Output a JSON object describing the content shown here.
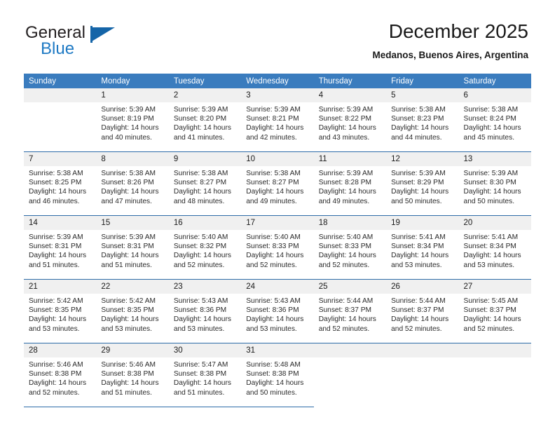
{
  "brand": {
    "name_part1": "General",
    "name_part2": "Blue",
    "logo_icon": "triangle-logo-icon",
    "accent_color": "#1565a8"
  },
  "header": {
    "month_title": "December 2025",
    "location": "Medanos, Buenos Aires, Argentina"
  },
  "theme": {
    "header_row_color": "#3a7cbe",
    "daynum_bg_color": "#f0f0f0",
    "week_separator_color": "#2d6ca8",
    "text_color": "#2a2a2a"
  },
  "calendar": {
    "weekday_headers": [
      "Sunday",
      "Monday",
      "Tuesday",
      "Wednesday",
      "Thursday",
      "Friday",
      "Saturday"
    ],
    "weeks": [
      [
        {
          "day": "",
          "blank": true
        },
        {
          "day": "1",
          "sunrise": "Sunrise: 5:39 AM",
          "sunset": "Sunset: 8:19 PM",
          "daylight": "Daylight: 14 hours and 40 minutes."
        },
        {
          "day": "2",
          "sunrise": "Sunrise: 5:39 AM",
          "sunset": "Sunset: 8:20 PM",
          "daylight": "Daylight: 14 hours and 41 minutes."
        },
        {
          "day": "3",
          "sunrise": "Sunrise: 5:39 AM",
          "sunset": "Sunset: 8:21 PM",
          "daylight": "Daylight: 14 hours and 42 minutes."
        },
        {
          "day": "4",
          "sunrise": "Sunrise: 5:39 AM",
          "sunset": "Sunset: 8:22 PM",
          "daylight": "Daylight: 14 hours and 43 minutes."
        },
        {
          "day": "5",
          "sunrise": "Sunrise: 5:38 AM",
          "sunset": "Sunset: 8:23 PM",
          "daylight": "Daylight: 14 hours and 44 minutes."
        },
        {
          "day": "6",
          "sunrise": "Sunrise: 5:38 AM",
          "sunset": "Sunset: 8:24 PM",
          "daylight": "Daylight: 14 hours and 45 minutes."
        }
      ],
      [
        {
          "day": "7",
          "sunrise": "Sunrise: 5:38 AM",
          "sunset": "Sunset: 8:25 PM",
          "daylight": "Daylight: 14 hours and 46 minutes."
        },
        {
          "day": "8",
          "sunrise": "Sunrise: 5:38 AM",
          "sunset": "Sunset: 8:26 PM",
          "daylight": "Daylight: 14 hours and 47 minutes."
        },
        {
          "day": "9",
          "sunrise": "Sunrise: 5:38 AM",
          "sunset": "Sunset: 8:27 PM",
          "daylight": "Daylight: 14 hours and 48 minutes."
        },
        {
          "day": "10",
          "sunrise": "Sunrise: 5:38 AM",
          "sunset": "Sunset: 8:27 PM",
          "daylight": "Daylight: 14 hours and 49 minutes."
        },
        {
          "day": "11",
          "sunrise": "Sunrise: 5:39 AM",
          "sunset": "Sunset: 8:28 PM",
          "daylight": "Daylight: 14 hours and 49 minutes."
        },
        {
          "day": "12",
          "sunrise": "Sunrise: 5:39 AM",
          "sunset": "Sunset: 8:29 PM",
          "daylight": "Daylight: 14 hours and 50 minutes."
        },
        {
          "day": "13",
          "sunrise": "Sunrise: 5:39 AM",
          "sunset": "Sunset: 8:30 PM",
          "daylight": "Daylight: 14 hours and 50 minutes."
        }
      ],
      [
        {
          "day": "14",
          "sunrise": "Sunrise: 5:39 AM",
          "sunset": "Sunset: 8:31 PM",
          "daylight": "Daylight: 14 hours and 51 minutes."
        },
        {
          "day": "15",
          "sunrise": "Sunrise: 5:39 AM",
          "sunset": "Sunset: 8:31 PM",
          "daylight": "Daylight: 14 hours and 51 minutes."
        },
        {
          "day": "16",
          "sunrise": "Sunrise: 5:40 AM",
          "sunset": "Sunset: 8:32 PM",
          "daylight": "Daylight: 14 hours and 52 minutes."
        },
        {
          "day": "17",
          "sunrise": "Sunrise: 5:40 AM",
          "sunset": "Sunset: 8:33 PM",
          "daylight": "Daylight: 14 hours and 52 minutes."
        },
        {
          "day": "18",
          "sunrise": "Sunrise: 5:40 AM",
          "sunset": "Sunset: 8:33 PM",
          "daylight": "Daylight: 14 hours and 52 minutes."
        },
        {
          "day": "19",
          "sunrise": "Sunrise: 5:41 AM",
          "sunset": "Sunset: 8:34 PM",
          "daylight": "Daylight: 14 hours and 53 minutes."
        },
        {
          "day": "20",
          "sunrise": "Sunrise: 5:41 AM",
          "sunset": "Sunset: 8:34 PM",
          "daylight": "Daylight: 14 hours and 53 minutes."
        }
      ],
      [
        {
          "day": "21",
          "sunrise": "Sunrise: 5:42 AM",
          "sunset": "Sunset: 8:35 PM",
          "daylight": "Daylight: 14 hours and 53 minutes."
        },
        {
          "day": "22",
          "sunrise": "Sunrise: 5:42 AM",
          "sunset": "Sunset: 8:35 PM",
          "daylight": "Daylight: 14 hours and 53 minutes."
        },
        {
          "day": "23",
          "sunrise": "Sunrise: 5:43 AM",
          "sunset": "Sunset: 8:36 PM",
          "daylight": "Daylight: 14 hours and 53 minutes."
        },
        {
          "day": "24",
          "sunrise": "Sunrise: 5:43 AM",
          "sunset": "Sunset: 8:36 PM",
          "daylight": "Daylight: 14 hours and 53 minutes."
        },
        {
          "day": "25",
          "sunrise": "Sunrise: 5:44 AM",
          "sunset": "Sunset: 8:37 PM",
          "daylight": "Daylight: 14 hours and 52 minutes."
        },
        {
          "day": "26",
          "sunrise": "Sunrise: 5:44 AM",
          "sunset": "Sunset: 8:37 PM",
          "daylight": "Daylight: 14 hours and 52 minutes."
        },
        {
          "day": "27",
          "sunrise": "Sunrise: 5:45 AM",
          "sunset": "Sunset: 8:37 PM",
          "daylight": "Daylight: 14 hours and 52 minutes."
        }
      ],
      [
        {
          "day": "28",
          "sunrise": "Sunrise: 5:46 AM",
          "sunset": "Sunset: 8:38 PM",
          "daylight": "Daylight: 14 hours and 52 minutes."
        },
        {
          "day": "29",
          "sunrise": "Sunrise: 5:46 AM",
          "sunset": "Sunset: 8:38 PM",
          "daylight": "Daylight: 14 hours and 51 minutes."
        },
        {
          "day": "30",
          "sunrise": "Sunrise: 5:47 AM",
          "sunset": "Sunset: 8:38 PM",
          "daylight": "Daylight: 14 hours and 51 minutes."
        },
        {
          "day": "31",
          "sunrise": "Sunrise: 5:48 AM",
          "sunset": "Sunset: 8:38 PM",
          "daylight": "Daylight: 14 hours and 50 minutes."
        },
        {
          "day": "",
          "empty": true
        },
        {
          "day": "",
          "empty": true
        },
        {
          "day": "",
          "empty": true
        }
      ]
    ]
  }
}
